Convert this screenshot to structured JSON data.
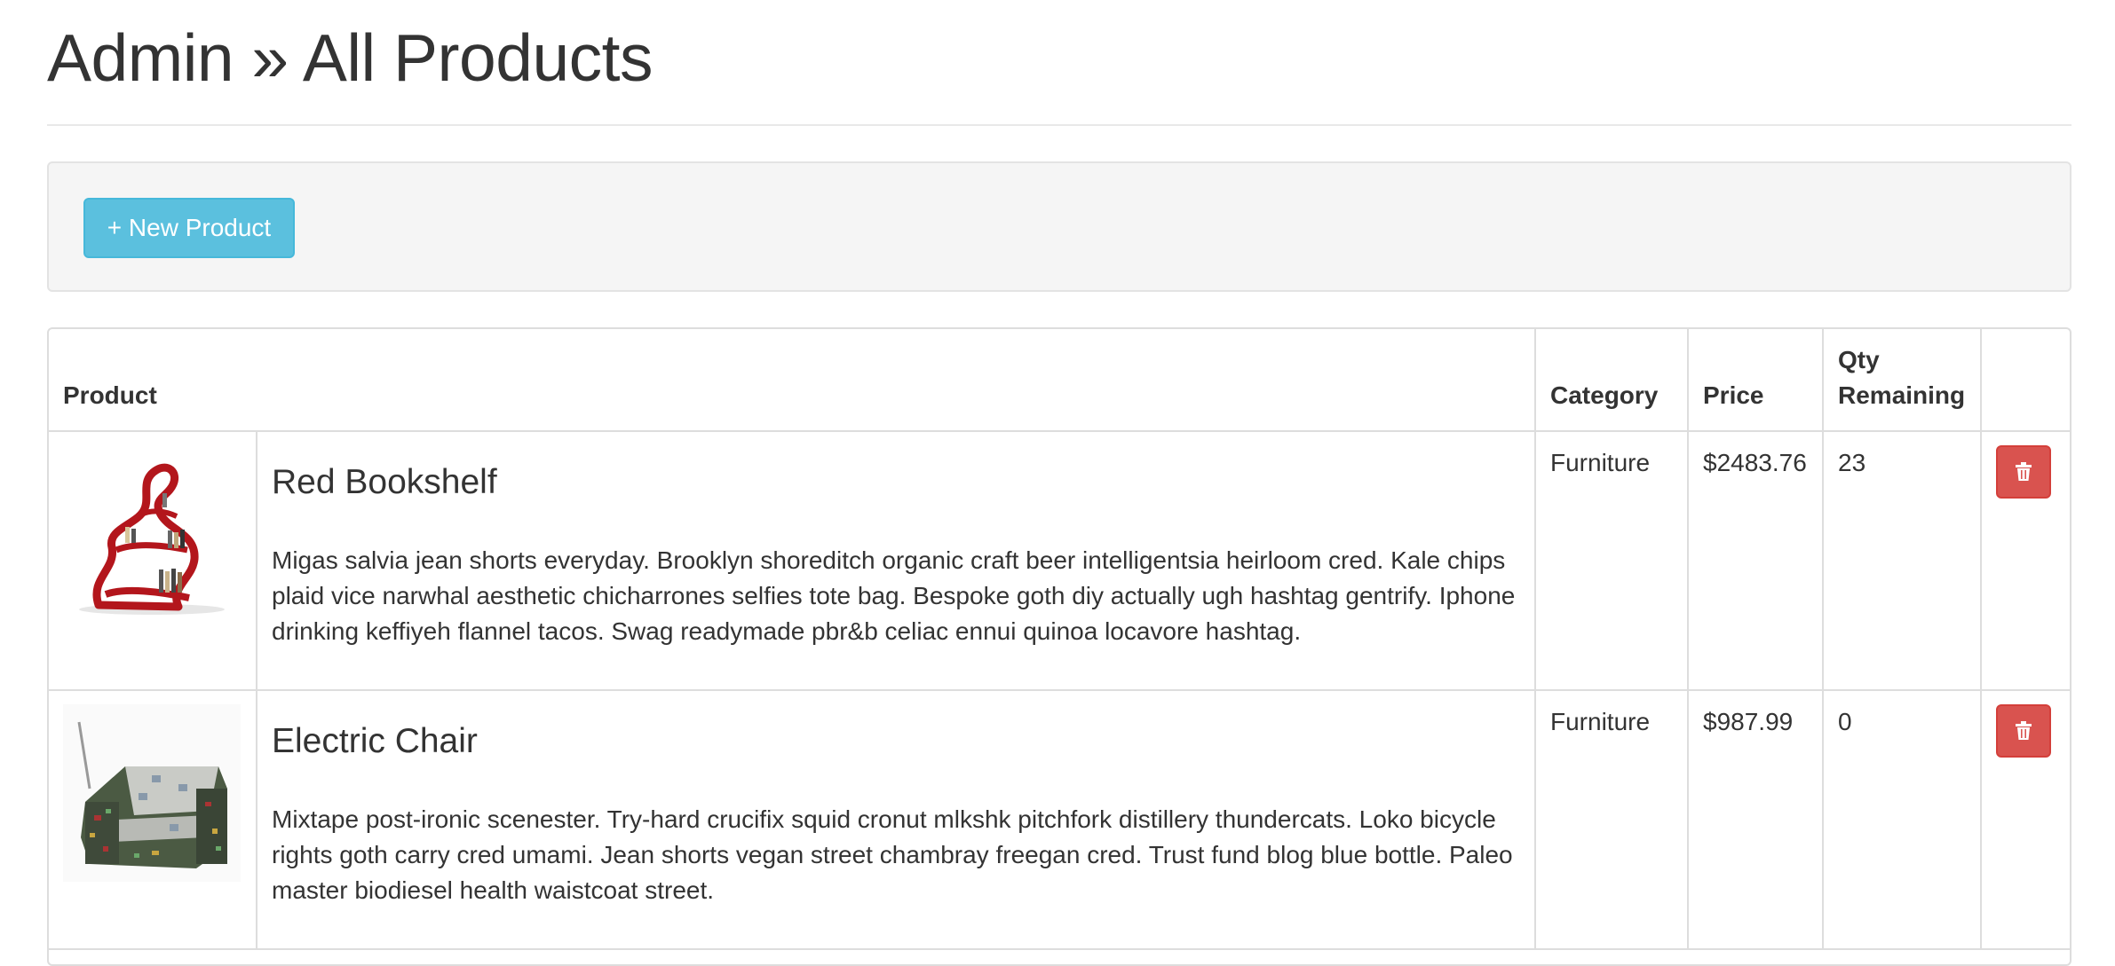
{
  "header": {
    "title": "Admin » All Products"
  },
  "toolbar": {
    "new_product_label": "+ New Product"
  },
  "table": {
    "columns": [
      "Product",
      "Category",
      "Price",
      "Qty Remaining",
      ""
    ],
    "rows": [
      {
        "name": "Red Bookshelf",
        "description": "Migas salvia jean shorts everyday. Brooklyn shoreditch organic craft beer intelligentsia heirloom cred. Kale chips plaid vice narwhal aesthetic chicharrones selfies tote bag. Bespoke goth diy actually ugh hashtag gentrify. Iphone drinking keffiyeh flannel tacos. Swag readymade pbr&b celiac ennui quinoa locavore hashtag.",
        "category": "Furniture",
        "price": "$2483.76",
        "qty": "23",
        "image_icon": "red-bookshelf-thumbnail"
      },
      {
        "name": "Electric Chair",
        "description": "Mixtape post-ironic scenester. Try-hard crucifix squid cronut mlkshk pitchfork distillery thundercats. Loko bicycle rights goth carry cred umami. Jean shorts vegan street chambray freegan cred. Trust fund blog blue bottle. Paleo master biodiesel health waistcoat street.",
        "category": "Furniture",
        "price": "$987.99",
        "qty": "0",
        "image_icon": "electric-chair-thumbnail"
      }
    ]
  },
  "colors": {
    "info_button": "#5bc0de",
    "danger_button": "#d9534f",
    "well_background": "#f5f5f5",
    "border": "#dddddd"
  }
}
